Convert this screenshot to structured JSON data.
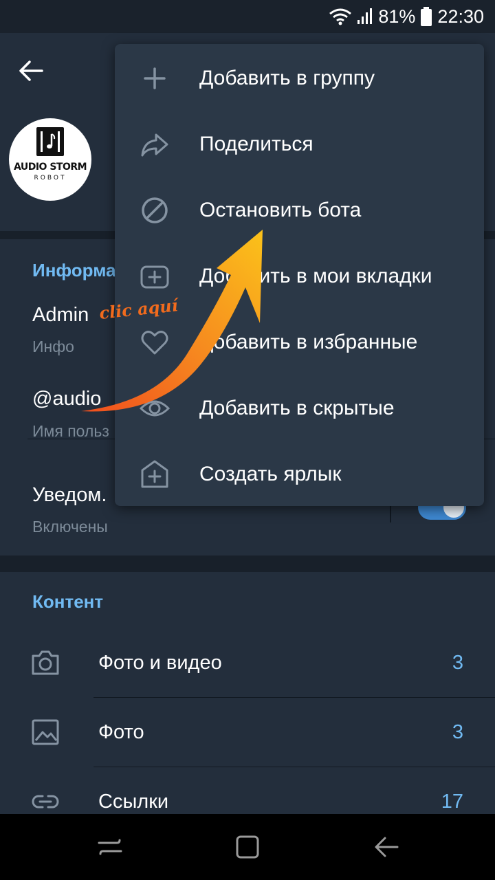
{
  "status_bar": {
    "battery": "81%",
    "time": "22:30"
  },
  "header": {
    "back_icon": "arrow-left-icon",
    "avatar": {
      "logo_line1": "AUDIO STORM",
      "logo_line2": "ROBOT"
    }
  },
  "info": {
    "title": "Информа",
    "bio": {
      "value": "Admin",
      "label": "Инфо"
    },
    "username": {
      "value": "@audio",
      "label": "Имя польз"
    },
    "notifications": {
      "value": "Уведом.",
      "label": "Включены",
      "enabled": true
    }
  },
  "content": {
    "title": "Контент",
    "rows": [
      {
        "icon": "camera-icon",
        "label": "Фото и видео",
        "count": "3"
      },
      {
        "icon": "image-icon",
        "label": "Фото",
        "count": "3"
      },
      {
        "icon": "link-icon",
        "label": "Ссылки",
        "count": "17"
      }
    ]
  },
  "menu": {
    "items": [
      {
        "icon": "plus-icon",
        "label": "Добавить в группу"
      },
      {
        "icon": "share-icon",
        "label": "Поделиться"
      },
      {
        "icon": "block-icon",
        "label": "Остановить бота"
      },
      {
        "icon": "add-tab-icon",
        "label": "Добавить в мои вкладки"
      },
      {
        "icon": "heart-icon",
        "label": "Добавить в избранные"
      },
      {
        "icon": "eye-icon",
        "label": "Добавить в скрытые"
      },
      {
        "icon": "add-shortcut-icon",
        "label": "Создать ярлык"
      }
    ]
  },
  "annotation": {
    "text": "clic aquí",
    "color": "#f26b1d"
  },
  "colors": {
    "accent": "#71baf2",
    "background": "#1d2733",
    "surface": "#232e3c",
    "menu_surface": "#2b3847",
    "toggle_on": "#3e88d1"
  }
}
